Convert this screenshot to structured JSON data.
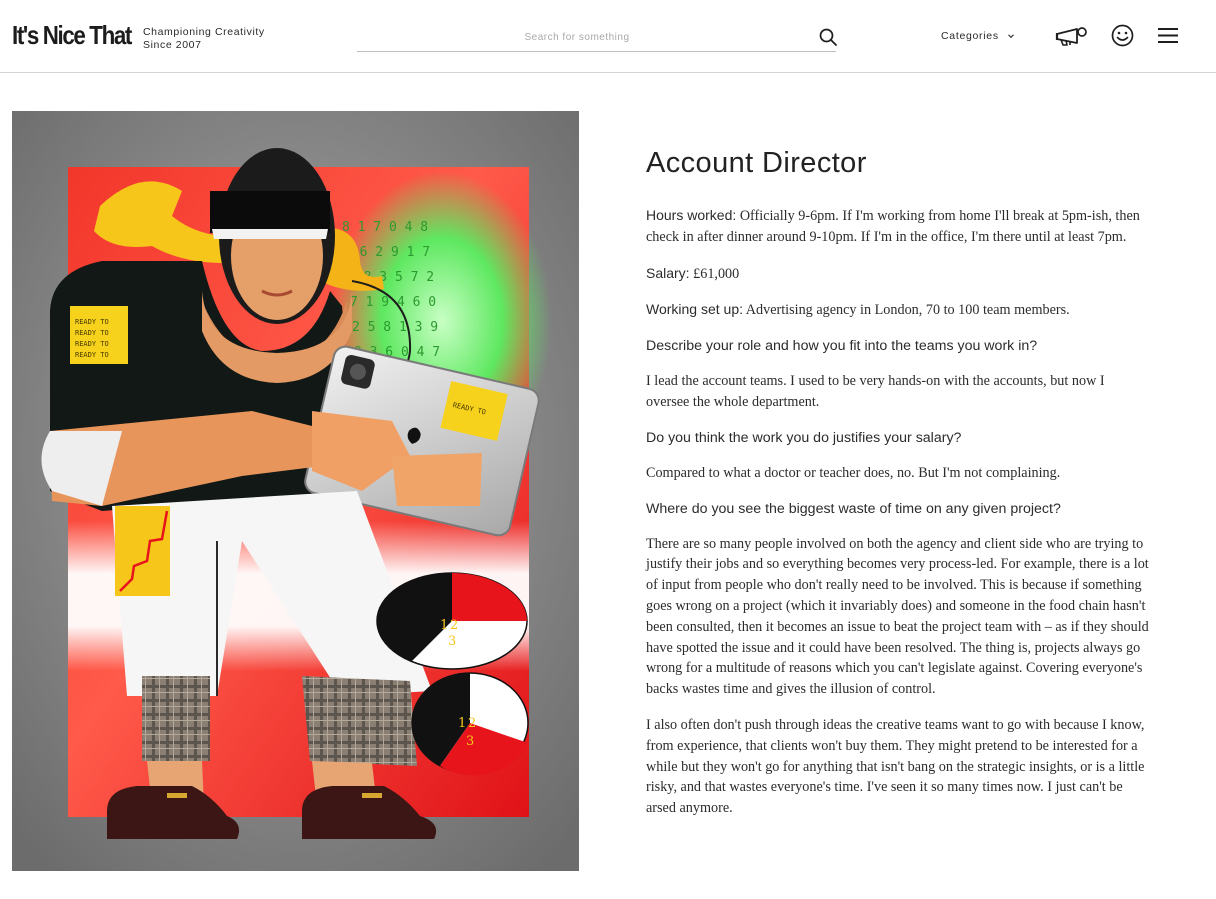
{
  "header": {
    "logo_text": "It's Nice That",
    "tagline_line1": "Championing Creativity",
    "tagline_line2": "Since 2007",
    "search_placeholder": "Search for something",
    "categories_label": "Categories",
    "icons": [
      "search-icon",
      "megaphone-icon",
      "smiley-icon",
      "hamburger-menu-icon"
    ]
  },
  "hero": {
    "sticky_note_text": "READY TO",
    "pie_labels": [
      "1",
      "2",
      "3"
    ],
    "colors": {
      "red": "#e8141b",
      "yellow": "#f6c61b",
      "green": "#57e85a",
      "black": "#111111"
    }
  },
  "article": {
    "title": "Account Director",
    "facts": [
      {
        "label": "Hours worked:",
        "value": " Officially 9-6pm. If I'm working from home I'll break at 5pm-ish, then check in after dinner around 9-10pm. If I'm in the office, I'm there until at least 7pm."
      },
      {
        "label": "Salary:",
        "value": " £61,000"
      },
      {
        "label": "Working set up:",
        "value": " Advertising agency in London, 70 to 100 team members."
      }
    ],
    "q1": "Describe your role and how you fit into the teams you work in?",
    "a1": "I lead the account teams. I used to be very hands-on with the accounts, but now I oversee the whole department.",
    "q2": "Do you think the work you do justifies your salary?",
    "a2": "Compared to what a doctor or teacher does, no. But I'm not complaining.",
    "q3": "Where do you see the biggest waste of time on any given project?",
    "a3": "There are so many people involved on both the agency and client side who are trying to justify their jobs and so everything becomes very process-led. For example, there is a lot of input from people who don't really need to be involved. This is because if something goes wrong on a project (which it invariably does) and someone in the food chain hasn't been consulted, then it becomes an issue to beat the project team with – as if they should have spotted the issue and it could have been resolved. The thing is, projects always go wrong for a multitude of reasons which you can't legislate against. Covering everyone's backs wastes time and gives the illusion of control.",
    "a4": "I also often don't push through ideas the creative teams want to go with because I know, from experience, that clients won't buy them. They might pretend to be interested for a while but they won't go for anything that isn't bang on the strategic insights, or is a little risky, and that wastes everyone's time. I've seen it so many times now. I just can't be arsed anymore."
  }
}
